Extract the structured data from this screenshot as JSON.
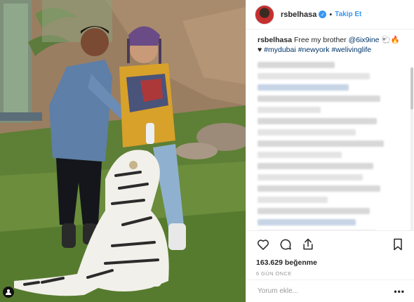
{
  "post": {
    "username": "rsbelhasa",
    "follow_label": "Takip Et",
    "separator": "•",
    "caption_user": "rsbelhasa",
    "caption_text": "Free my brother",
    "caption_mention": "@6ix9ine",
    "caption_emoji": "🐑🔥",
    "caption_heart": "♥",
    "hashtags": [
      "#mydubai",
      "#newyork",
      "#welivinglife"
    ],
    "likes": "163.629 beğenme",
    "timestamp": "6 GÜN ÖNCE",
    "comment_placeholder": "Yorum ekle...",
    "more_label": "•••"
  },
  "colors": {
    "link": "#003569",
    "accent": "#3897f0",
    "muted": "#999999"
  },
  "icons": [
    "verified-icon",
    "heart-icon",
    "comment-icon",
    "share-icon",
    "bookmark-icon",
    "tag-person-icon"
  ]
}
